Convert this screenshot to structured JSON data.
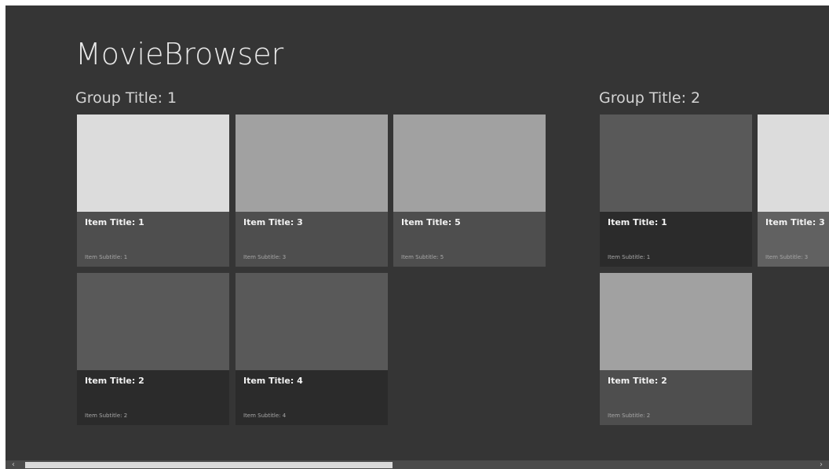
{
  "app": {
    "title": "MovieBrowser"
  },
  "groups": [
    {
      "title": "Group Title: 1",
      "items": [
        {
          "title": "Item Title: 1",
          "subtitle": "Item Subtitle: 1"
        },
        {
          "title": "Item Title: 2",
          "subtitle": "Item Subtitle: 2"
        },
        {
          "title": "Item Title: 3",
          "subtitle": "Item Subtitle: 3"
        },
        {
          "title": "Item Title: 4",
          "subtitle": "Item Subtitle: 4"
        },
        {
          "title": "Item Title: 5",
          "subtitle": "Item Subtitle: 5"
        }
      ]
    },
    {
      "title": "Group Title: 2",
      "items": [
        {
          "title": "Item Title: 1",
          "subtitle": "Item Subtitle: 1"
        },
        {
          "title": "Item Title: 2",
          "subtitle": "Item Subtitle: 2"
        },
        {
          "title": "Item Title: 3",
          "subtitle": "Item Subtitle: 3"
        }
      ]
    }
  ],
  "scrollbar": {
    "left_arrow": "‹",
    "right_arrow": "›"
  },
  "colors": {
    "background": "#353535",
    "tile_light": "#dcdcdc",
    "tile_mid": "#a1a1a1",
    "tile_dark": "#595959",
    "caption_mid": "#4e4e4e",
    "caption_dark": "#2b2b2b",
    "caption_alt": "#616161"
  }
}
